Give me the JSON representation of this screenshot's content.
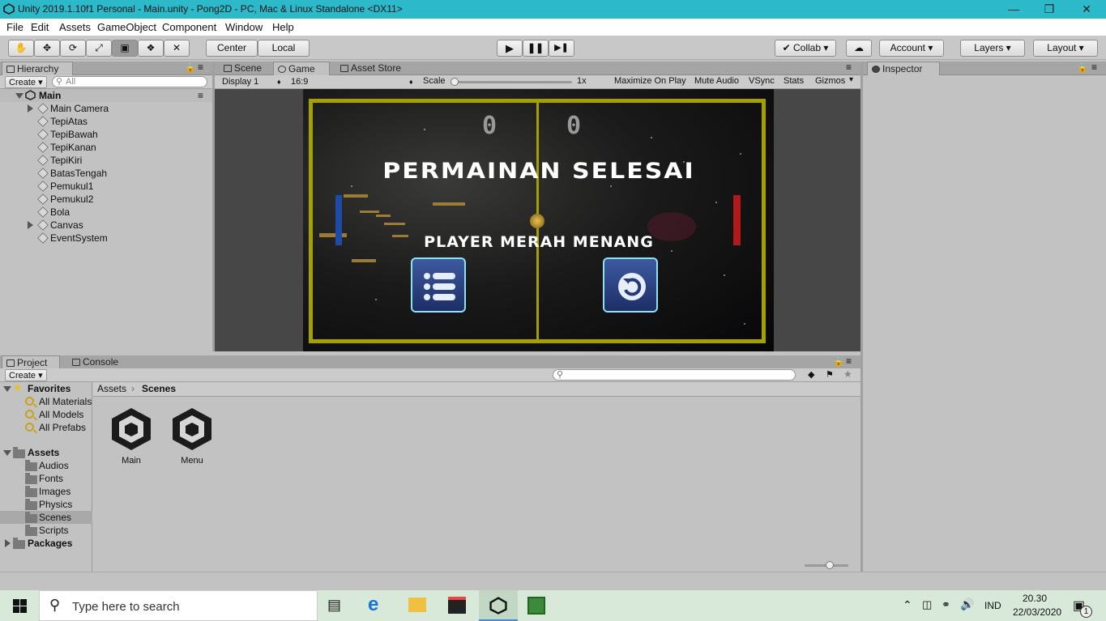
{
  "window": {
    "title": "Unity 2019.1.10f1 Personal - Main.unity - Pong2D - PC, Mac & Linux Standalone <DX11>",
    "min_icon": "minimize-icon",
    "restore_icon": "restore-icon",
    "close_icon": "close-icon"
  },
  "menubar": [
    "File",
    "Edit",
    "Assets",
    "GameObject",
    "Component",
    "Window",
    "Help"
  ],
  "toolbar": {
    "pivot_label": "Center",
    "space_label": "Local",
    "collab_label": "Collab",
    "account_label": "Account",
    "layers_label": "Layers",
    "layout_label": "Layout"
  },
  "hierarchy": {
    "tab": "Hierarchy",
    "create": "Create",
    "search_placeholder": "All",
    "scene_name": "Main",
    "items": [
      {
        "name": "Main Camera",
        "expandable": true
      },
      {
        "name": "TepiAtas"
      },
      {
        "name": "TepiBawah"
      },
      {
        "name": "TepiKanan"
      },
      {
        "name": "TepiKiri"
      },
      {
        "name": "BatasTengah"
      },
      {
        "name": "Pemukul1"
      },
      {
        "name": "Pemukul2"
      },
      {
        "name": "Bola"
      },
      {
        "name": "Canvas",
        "expandable": true
      },
      {
        "name": "EventSystem"
      }
    ]
  },
  "game_view": {
    "tabs": [
      "Scene",
      "Game",
      "Asset Store"
    ],
    "display": "Display 1",
    "aspect": "16:9",
    "scale_label": "Scale",
    "scale_value": "1x",
    "toggles": [
      "Maximize On Play",
      "Mute Audio",
      "VSync",
      "Stats",
      "Gizmos"
    ],
    "score_left": "0",
    "score_right": "0",
    "title_text": "PERMAINAN SELESAI",
    "winner_text": "PLAYER MERAH MENANG",
    "colors": {
      "border": "#a3a000",
      "left_paddle": "#1e4aa8",
      "right_paddle": "#b01a1a"
    }
  },
  "inspector": {
    "tab": "Inspector"
  },
  "project": {
    "tabs": [
      "Project",
      "Console"
    ],
    "create": "Create",
    "favorites_label": "Favorites",
    "favorites": [
      "All Materials",
      "All Models",
      "All Prefabs"
    ],
    "assets_label": "Assets",
    "folders": [
      "Audios",
      "Fonts",
      "Images",
      "Physics",
      "Scenes",
      "Scripts"
    ],
    "selected_folder": "Scenes",
    "packages_label": "Packages",
    "breadcrumb": [
      "Assets",
      "Scenes"
    ],
    "files": [
      "Main",
      "Menu"
    ]
  },
  "taskbar": {
    "search_placeholder": "Type here to search",
    "language": "IND",
    "time": "20.30",
    "date": "22/03/2020",
    "notification_count": "1"
  }
}
